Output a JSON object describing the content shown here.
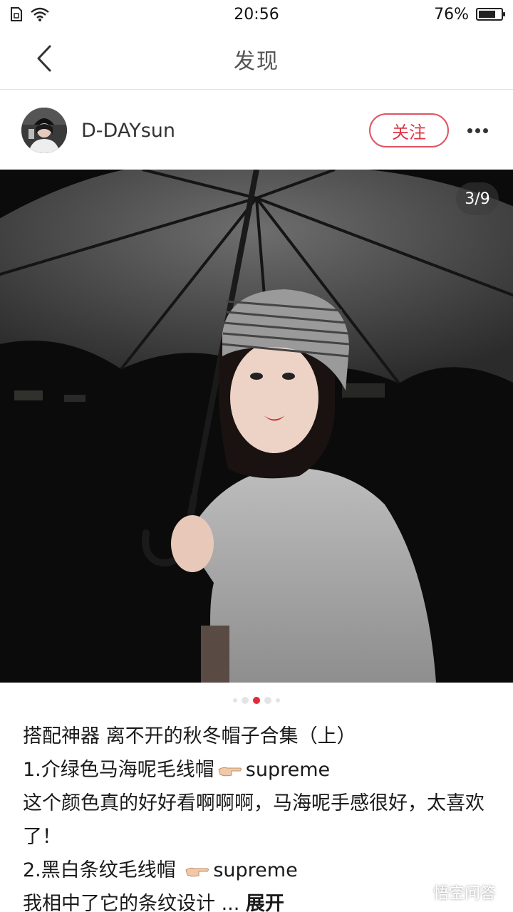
{
  "status_bar": {
    "time": "20:56",
    "battery_percent": "76%",
    "battery_level": 0.76
  },
  "header": {
    "title": "发现"
  },
  "author": {
    "name": "D-DAYsun",
    "follow_label": "关注"
  },
  "gallery": {
    "counter": "3/9",
    "total": 5,
    "active_index": 2
  },
  "post": {
    "title_line": "搭配神器 离不开的秋冬帽子合集（上）",
    "item1_name": "1.介绿色马海呢毛线帽",
    "item1_brand": "supreme",
    "item1_desc": "这个颜色真的好好看啊啊啊，马海呢手感很好，太喜欢了！",
    "item2_name": "2.黑白条纹毛线帽 ",
    "item2_brand": "supreme",
    "item3_desc": "我相中了它的条纹设计",
    "ellipsis": " ... ",
    "expand_label": "展开"
  },
  "icons": {
    "back": "chevron-left-icon",
    "more": "more-dots-icon",
    "pointing": "backhand-index-pointing-right-icon"
  },
  "watermark": "悟空问答",
  "colors": {
    "accent": "#e03345",
    "follow_border": "#e05463",
    "active_dot": "#e02b3c"
  }
}
